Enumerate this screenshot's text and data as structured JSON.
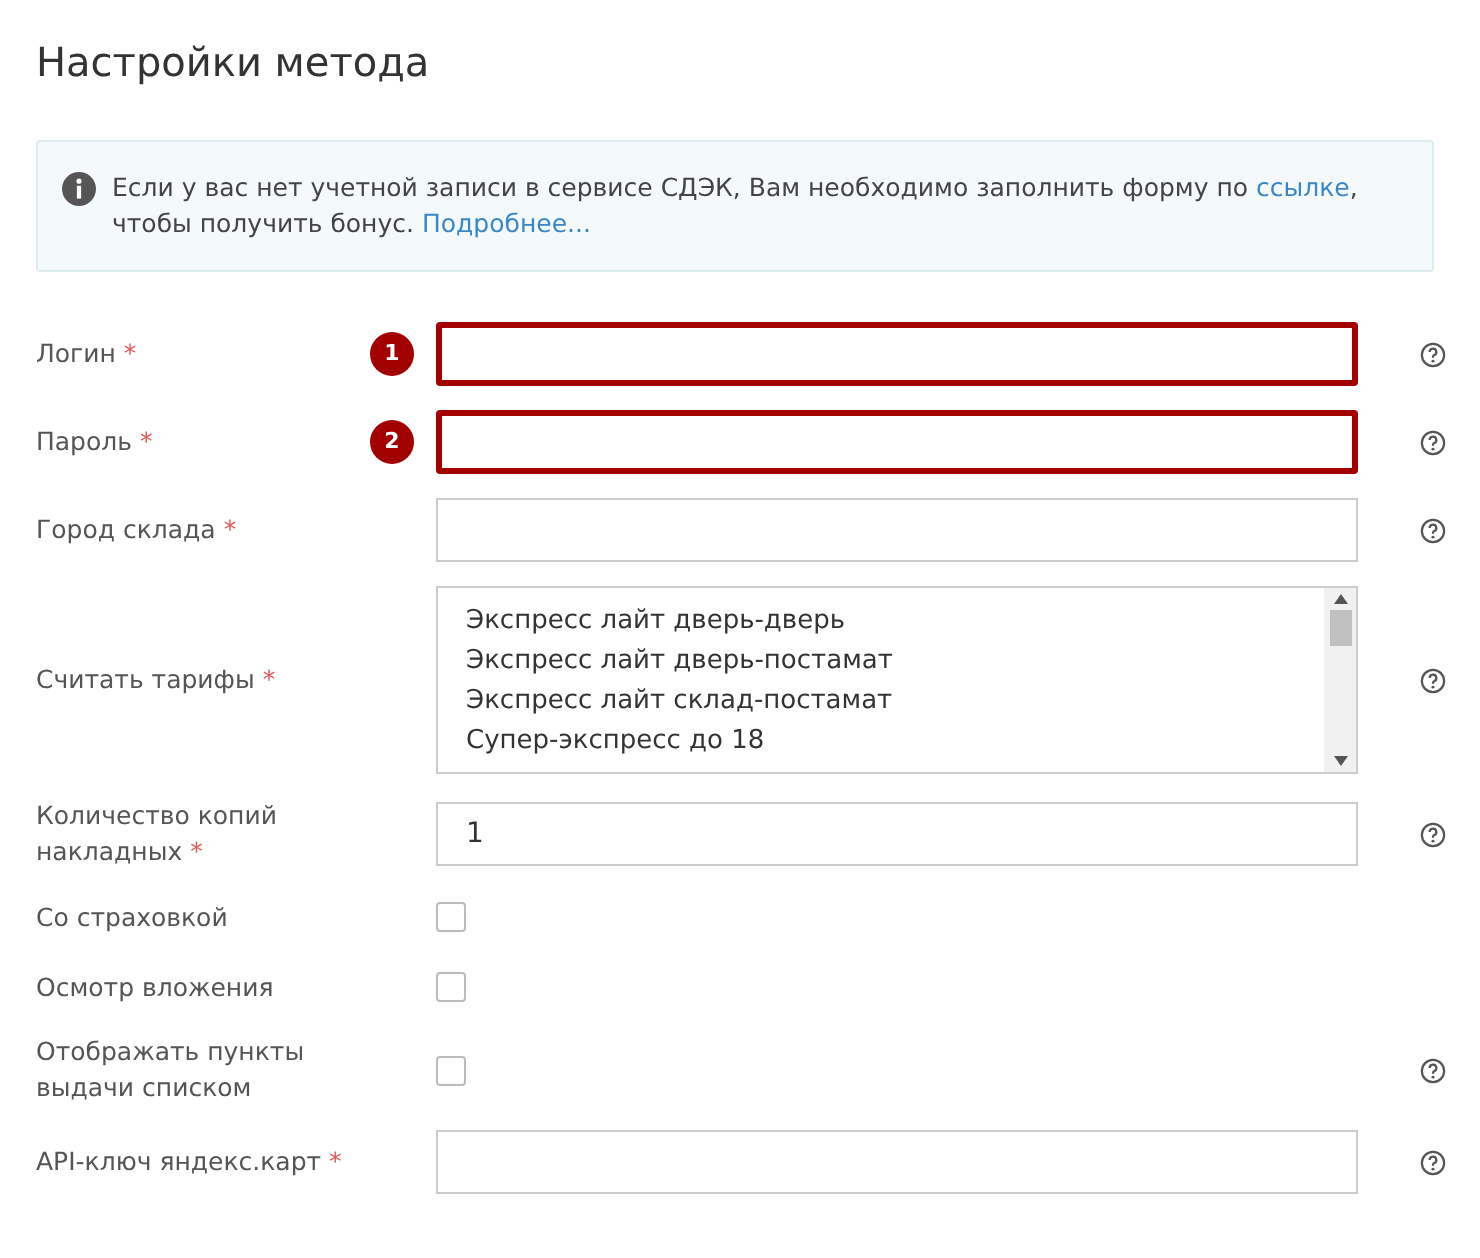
{
  "title": "Настройки метода",
  "notice": {
    "text": "Если у вас нет учетной записи в сервисе СДЭК, Вам необходимо заполнить форму по",
    "link": "ссылке",
    "text_after": ", чтобы получить бонус.",
    "more_link": "Подробнее..."
  },
  "fields": [
    {
      "kind": "text",
      "label": "Логин",
      "required_mark": "*",
      "marker": "1",
      "highlighted": true,
      "help": true
    },
    {
      "kind": "text",
      "label": "Пароль",
      "required_mark": "*",
      "marker": "2",
      "highlighted": true,
      "help": true
    },
    {
      "kind": "text",
      "label": "Город склада",
      "required_mark": "*",
      "highlighted": false,
      "help": true
    },
    {
      "kind": "listbox",
      "label": "Считать тарифы",
      "required_mark": "*",
      "help": true,
      "options": [
        "Экспресс лайт дверь-дверь",
        "Экспресс лайт дверь-постамат",
        "Экспресс лайт склад-постамат",
        "Супер-экспресс до 18"
      ]
    },
    {
      "kind": "text",
      "label": "Количество копий накладных",
      "required_mark": "*",
      "highlighted": false,
      "help": true,
      "value": "1"
    },
    {
      "kind": "checkbox",
      "label": "Со страховкой",
      "checked": false
    },
    {
      "kind": "checkbox",
      "label": "Осмотр вложения",
      "checked": false
    },
    {
      "kind": "checkbox",
      "label": "Отображать пункты выдачи списком",
      "checked": false,
      "help": true
    },
    {
      "kind": "text",
      "label": "API-ключ яндекс.карт",
      "required_mark": "*",
      "highlighted": false,
      "help": true
    }
  ]
}
